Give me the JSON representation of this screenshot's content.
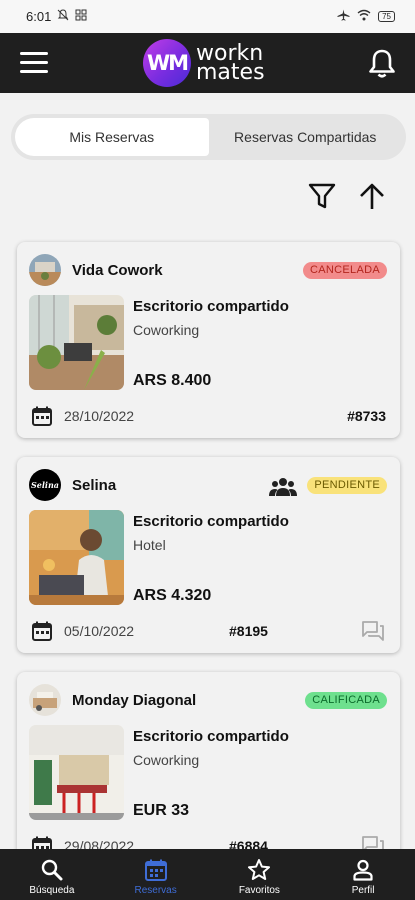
{
  "status_bar": {
    "time": "6:01",
    "battery": "75"
  },
  "header": {
    "logo_initials": "WM",
    "logo_line1": "workn",
    "logo_line2": "mates"
  },
  "tabs": [
    {
      "label": "Mis Reservas",
      "active": true
    },
    {
      "label": "Reservas Compartidas",
      "active": false
    }
  ],
  "toolbar": {
    "filter_icon": "filter-icon",
    "sort_icon": "sort-arrow-up-icon"
  },
  "reservations": [
    {
      "place": "Vida Cowork",
      "status": "CANCELADA",
      "status_bg": "#f28b8b",
      "status_color": "#b3261e",
      "title": "Escritorio compartido",
      "type": "Coworking",
      "price": "ARS 8.400",
      "date": "28/10/2022",
      "number": "#8733"
    },
    {
      "place": "Selina",
      "avatar_text": "Selina",
      "status": "PENDIENTE",
      "status_bg": "#f9e27a",
      "status_color": "#6b5a00",
      "title": "Escritorio compartido",
      "type": "Hotel",
      "price": "ARS 4.320",
      "date": "05/10/2022",
      "number": "#8195"
    },
    {
      "place": "Monday Diagonal",
      "status": "CALIFICADA",
      "status_bg": "#6ee08e",
      "status_color": "#0b6b2b",
      "title": "Escritorio compartido",
      "type": "Coworking",
      "price": "EUR 33",
      "date": "29/08/2022",
      "number": "#6884"
    }
  ],
  "bottom_nav": [
    {
      "label": "Búsqueda",
      "icon": "search-icon",
      "active": false
    },
    {
      "label": "Reservas",
      "icon": "calendar-icon",
      "active": true
    },
    {
      "label": "Favoritos",
      "icon": "star-icon",
      "active": false
    },
    {
      "label": "Perfil",
      "icon": "person-icon",
      "active": false
    }
  ],
  "colors": {
    "accent": "#3f6dd6",
    "appbar": "#1f1f1f"
  }
}
